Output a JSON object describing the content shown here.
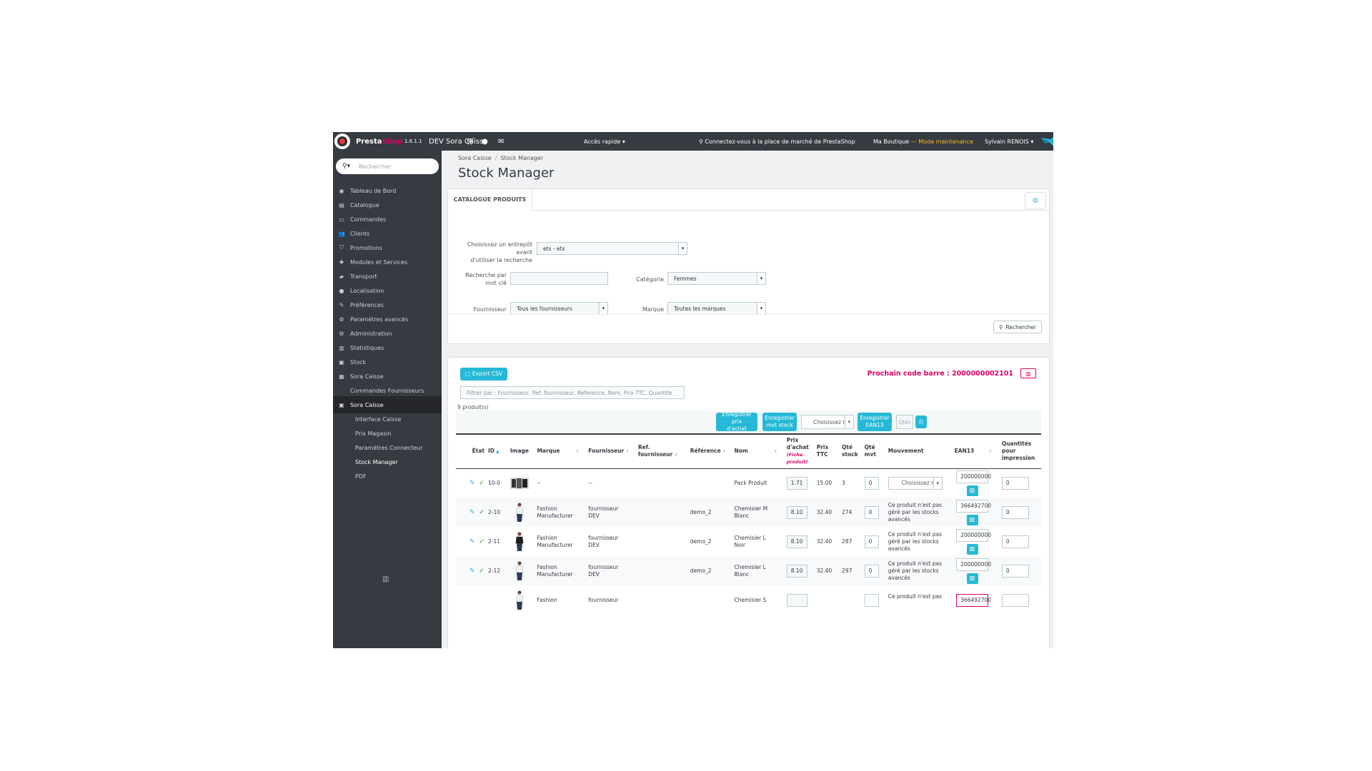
{
  "topbar": {
    "brand_a": "Presta",
    "brand_b": "Shop",
    "version": "1.6.1.1",
    "shop_name": "DEV Sora Caisse",
    "quick_access": "Accès rapide",
    "marketplace": "Connectez-vous à la place de marché de PrestaShop",
    "boutique": "Ma Boutique",
    "maintenance": "— Mode maintenance",
    "user": "Sylvain RENOIS"
  },
  "sidebar": {
    "search_placeholder": "Rechercher",
    "items": [
      {
        "label": "Tableau de Bord",
        "icon": "dashboard-icon",
        "glyph": "◉"
      },
      {
        "label": "Catalogue",
        "icon": "catalog-icon",
        "glyph": "▤"
      },
      {
        "label": "Commandes",
        "icon": "orders-icon",
        "glyph": "▭"
      },
      {
        "label": "Clients",
        "icon": "customers-icon",
        "glyph": "👥"
      },
      {
        "label": "Promotions",
        "icon": "tag-icon",
        "glyph": "⛉"
      },
      {
        "label": "Modules et Services",
        "icon": "puzzle-icon",
        "glyph": "✚"
      },
      {
        "label": "Transport",
        "icon": "truck-icon",
        "glyph": "▰"
      },
      {
        "label": "Localisation",
        "icon": "globe-icon",
        "glyph": "●"
      },
      {
        "label": "Préférences",
        "icon": "wrench-icon",
        "glyph": "✎"
      },
      {
        "label": "Paramètres avancés",
        "icon": "cogs-icon",
        "glyph": "⚙"
      },
      {
        "label": "Administration",
        "icon": "gear-icon",
        "glyph": "⚙"
      },
      {
        "label": "Statistiques",
        "icon": "chart-icon",
        "glyph": "▥"
      },
      {
        "label": "Stock",
        "icon": "box-icon",
        "glyph": "▣"
      },
      {
        "label": "Sora Caisse",
        "icon": "grid-icon",
        "glyph": "▦"
      },
      {
        "label": "Commandes Fournisseurs",
        "icon": "",
        "glyph": ""
      },
      {
        "label": "Sora Caisse",
        "icon": "register-icon",
        "glyph": "▣"
      }
    ],
    "sub_items": [
      "Interface Caisse",
      "Prix Magasin",
      "Paramètres Connecteur",
      "Stock Manager",
      "PDF"
    ]
  },
  "breadcrumb": {
    "parent": "Sora Caisse",
    "sep": "/",
    "current": "Stock Manager"
  },
  "page_title": "Stock Manager",
  "catalog_panel": {
    "tab": "CATALOGUE PRODUITS",
    "warehouse_label_1": "Choisissez un entrepôt avant",
    "warehouse_label_2": "d'utiliser la recherche",
    "warehouse_value": "ets - ets",
    "keyword_label_1": "Recherche par",
    "keyword_label_2": "mot clé",
    "category_label": "Catégorie",
    "category_value": "Femmes",
    "supplier_label": "Fournisseur",
    "supplier_value": "Tous les fournisseurs",
    "brand_label": "Marque",
    "brand_value": "Toutes les marques",
    "search_button": "Rechercher"
  },
  "stock_panel": {
    "export_button": "Export CSV",
    "next_barcode": "Prochain code barre : 2000000002101",
    "filter_placeholder": "Filtrer par : Fournisseur, Ref. fournisseur, Reference, Nom, Prix TTC, Quantite",
    "count": "9 produit(s)",
    "btn_save_purchase_1": "Enregistrer prix",
    "btn_save_purchase_2": "d'achat",
    "btn_save_stock_1": "Enregistrer",
    "btn_save_stock_2": "mvt stock",
    "mvt_select": "Choisissez mo",
    "btn_save_ean_1": "Enregistrer",
    "btn_save_ean_2": "EAN13",
    "qtes_placeholder": "Qtés"
  },
  "table": {
    "headers": {
      "etat": "État",
      "id": "ID",
      "image": "Image",
      "marque": "Marque",
      "fournisseur": "Fournisseur",
      "ref_fournisseur": "Ref. fournisseur",
      "reference": "Référence",
      "nom": "Nom",
      "prix_achat_1": "Prix",
      "prix_achat_2": "d'achat",
      "prix_achat_sub_1": "(Fiche",
      "prix_achat_sub_2": "produit)",
      "prix_ttc_1": "Prix",
      "prix_ttc_2": "TTC",
      "qte_stock_1": "Qté",
      "qte_stock_2": "stock",
      "qte_mvt_1": "Qté",
      "qte_mvt_2": "mvt",
      "mouvement": "Mouvement",
      "ean13": "EAN13",
      "qte_print_1": "Quantités",
      "qte_print_2": "pour",
      "qte_print_3": "impression"
    },
    "rows": [
      {
        "id": "10-0",
        "marque_1": "--",
        "marque_2": "",
        "fournisseur_1": "--",
        "fournisseur_2": "",
        "ref": "",
        "nom_1": "Pack Produit",
        "nom_2": "",
        "achat": "1.71",
        "ttc": "15.00",
        "stock": "3",
        "mvt": "0",
        "mouvement": "select",
        "mv_1": "",
        "mv_2": "",
        "mv_3": "",
        "ean": "200000000",
        "print": "0",
        "img": "pack"
      },
      {
        "id": "2-10",
        "marque_1": "Fashion",
        "marque_2": "Manufacturer",
        "fournisseur_1": "fournisseur",
        "fournisseur_2": "DEV",
        "ref": "demo_2",
        "nom_1": "Chemisier M",
        "nom_2": "Blanc",
        "achat": "8.10",
        "ttc": "32.40",
        "stock": "274",
        "mvt": "0",
        "mouvement": "text",
        "mv_1": "Ce produit n'est pas",
        "mv_2": "géré par les stocks",
        "mv_3": "avancés",
        "ean": "366492700",
        "print": "0",
        "img": "white"
      },
      {
        "id": "2-11",
        "marque_1": "Fashion",
        "marque_2": "Manufacturer",
        "fournisseur_1": "fournisseur",
        "fournisseur_2": "DEV",
        "ref": "demo_2",
        "nom_1": "Chemisier L",
        "nom_2": "Noir",
        "achat": "8.10",
        "ttc": "32.40",
        "stock": "287",
        "mvt": "0",
        "mouvement": "text",
        "mv_1": "Ce produit n'est pas",
        "mv_2": "géré par les stocks",
        "mv_3": "avancés",
        "ean": "200000000",
        "print": "0",
        "img": "black"
      },
      {
        "id": "2-12",
        "marque_1": "Fashion",
        "marque_2": "Manufacturer",
        "fournisseur_1": "fournisseur",
        "fournisseur_2": "DEV",
        "ref": "demo_2",
        "nom_1": "Chemisier L",
        "nom_2": "Blanc",
        "achat": "8.10",
        "ttc": "32.40",
        "stock": "297",
        "mvt": "0",
        "mouvement": "text",
        "mv_1": "Ce produit n'est pas",
        "mv_2": "géré par les stocks",
        "mv_3": "avancés",
        "ean": "200000000",
        "print": "0",
        "img": "white"
      },
      {
        "id": "",
        "marque_1": "Fashion",
        "marque_2": "",
        "fournisseur_1": "fournisseur",
        "fournisseur_2": "",
        "ref": "",
        "nom_1": "Chemisier S",
        "nom_2": "",
        "achat": "",
        "ttc": "",
        "stock": "",
        "mvt": "",
        "mouvement": "text",
        "mv_1": "Ce produit n'est pas",
        "mv_2": "",
        "mv_3": "",
        "ean": "366492700",
        "print": "",
        "img": "white",
        "partial": true
      }
    ]
  },
  "colors": {
    "accent": "#25b9d7",
    "brand": "#df0067",
    "maintenance": "#fbbb22",
    "dark": "#363a41",
    "check": "#72c279"
  }
}
